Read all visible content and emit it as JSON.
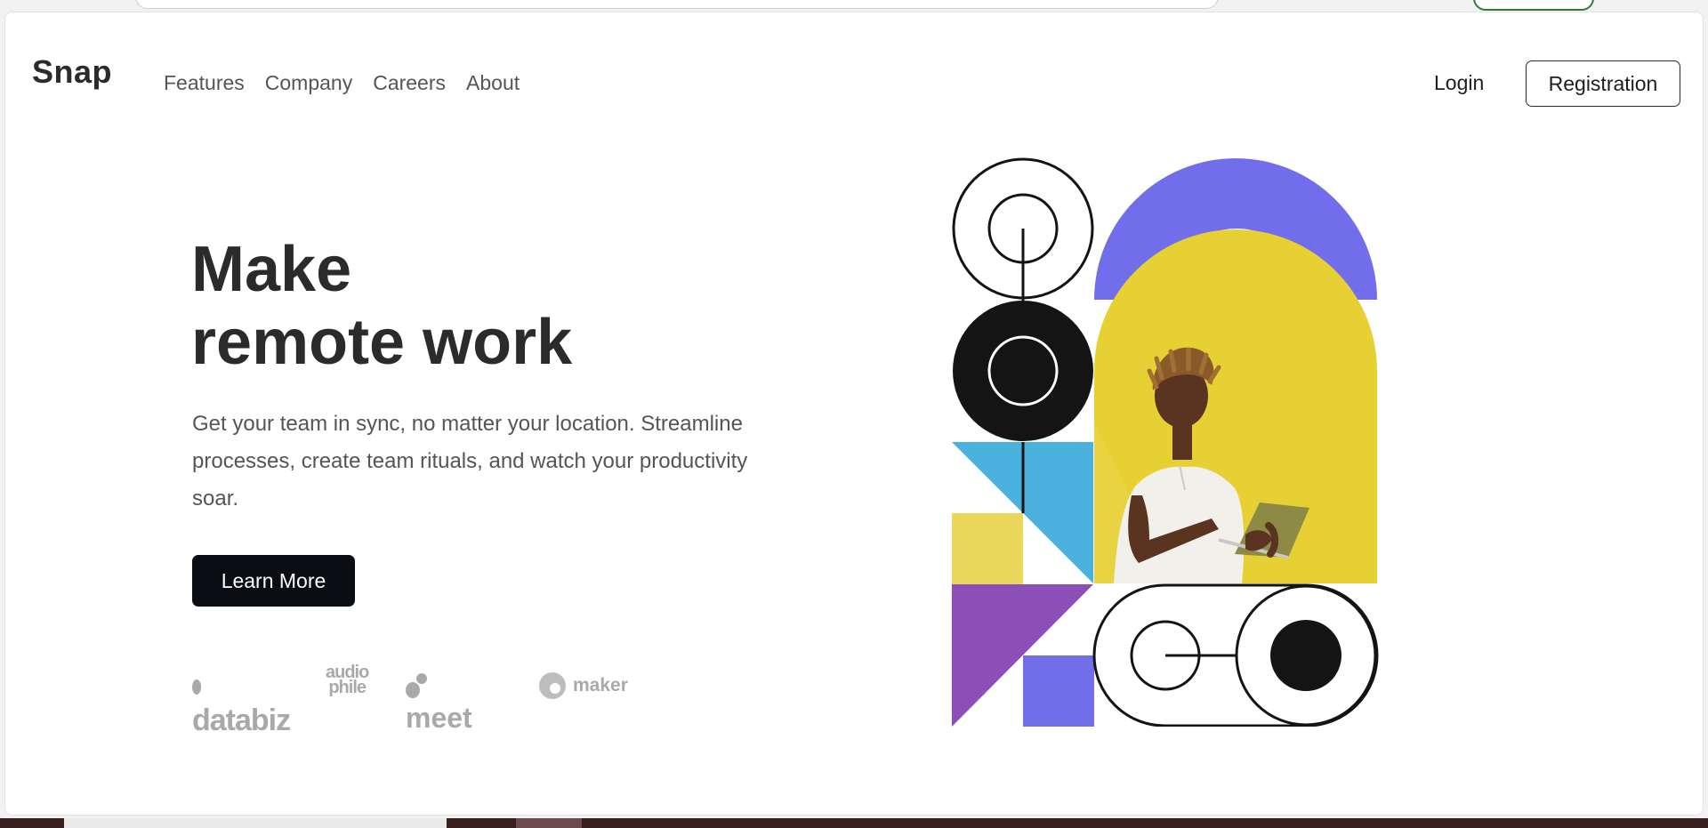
{
  "brand": {
    "name": "Snap"
  },
  "nav": {
    "items": [
      {
        "label": "Features"
      },
      {
        "label": "Company"
      },
      {
        "label": "Careers"
      },
      {
        "label": "About"
      }
    ],
    "login_label": "Login",
    "register_label": "Registration"
  },
  "hero": {
    "title_line1": "Make",
    "title_line2": "remote work",
    "copy": "Get your team in sync, no matter your location. Streamline processes, create team rituals, and watch your productivity soar.",
    "cta_label": "Learn More"
  },
  "clients": [
    {
      "name": "databiz"
    },
    {
      "name_line1": "audio",
      "name_line2": "phile"
    },
    {
      "name": "meet"
    },
    {
      "name": "maker"
    }
  ],
  "colors": {
    "accent_blue_violet": "#716deb",
    "yellow": "#e6d034",
    "cyan": "#4ab0de",
    "purple": "#8c4fb8",
    "dark": "#141414"
  }
}
